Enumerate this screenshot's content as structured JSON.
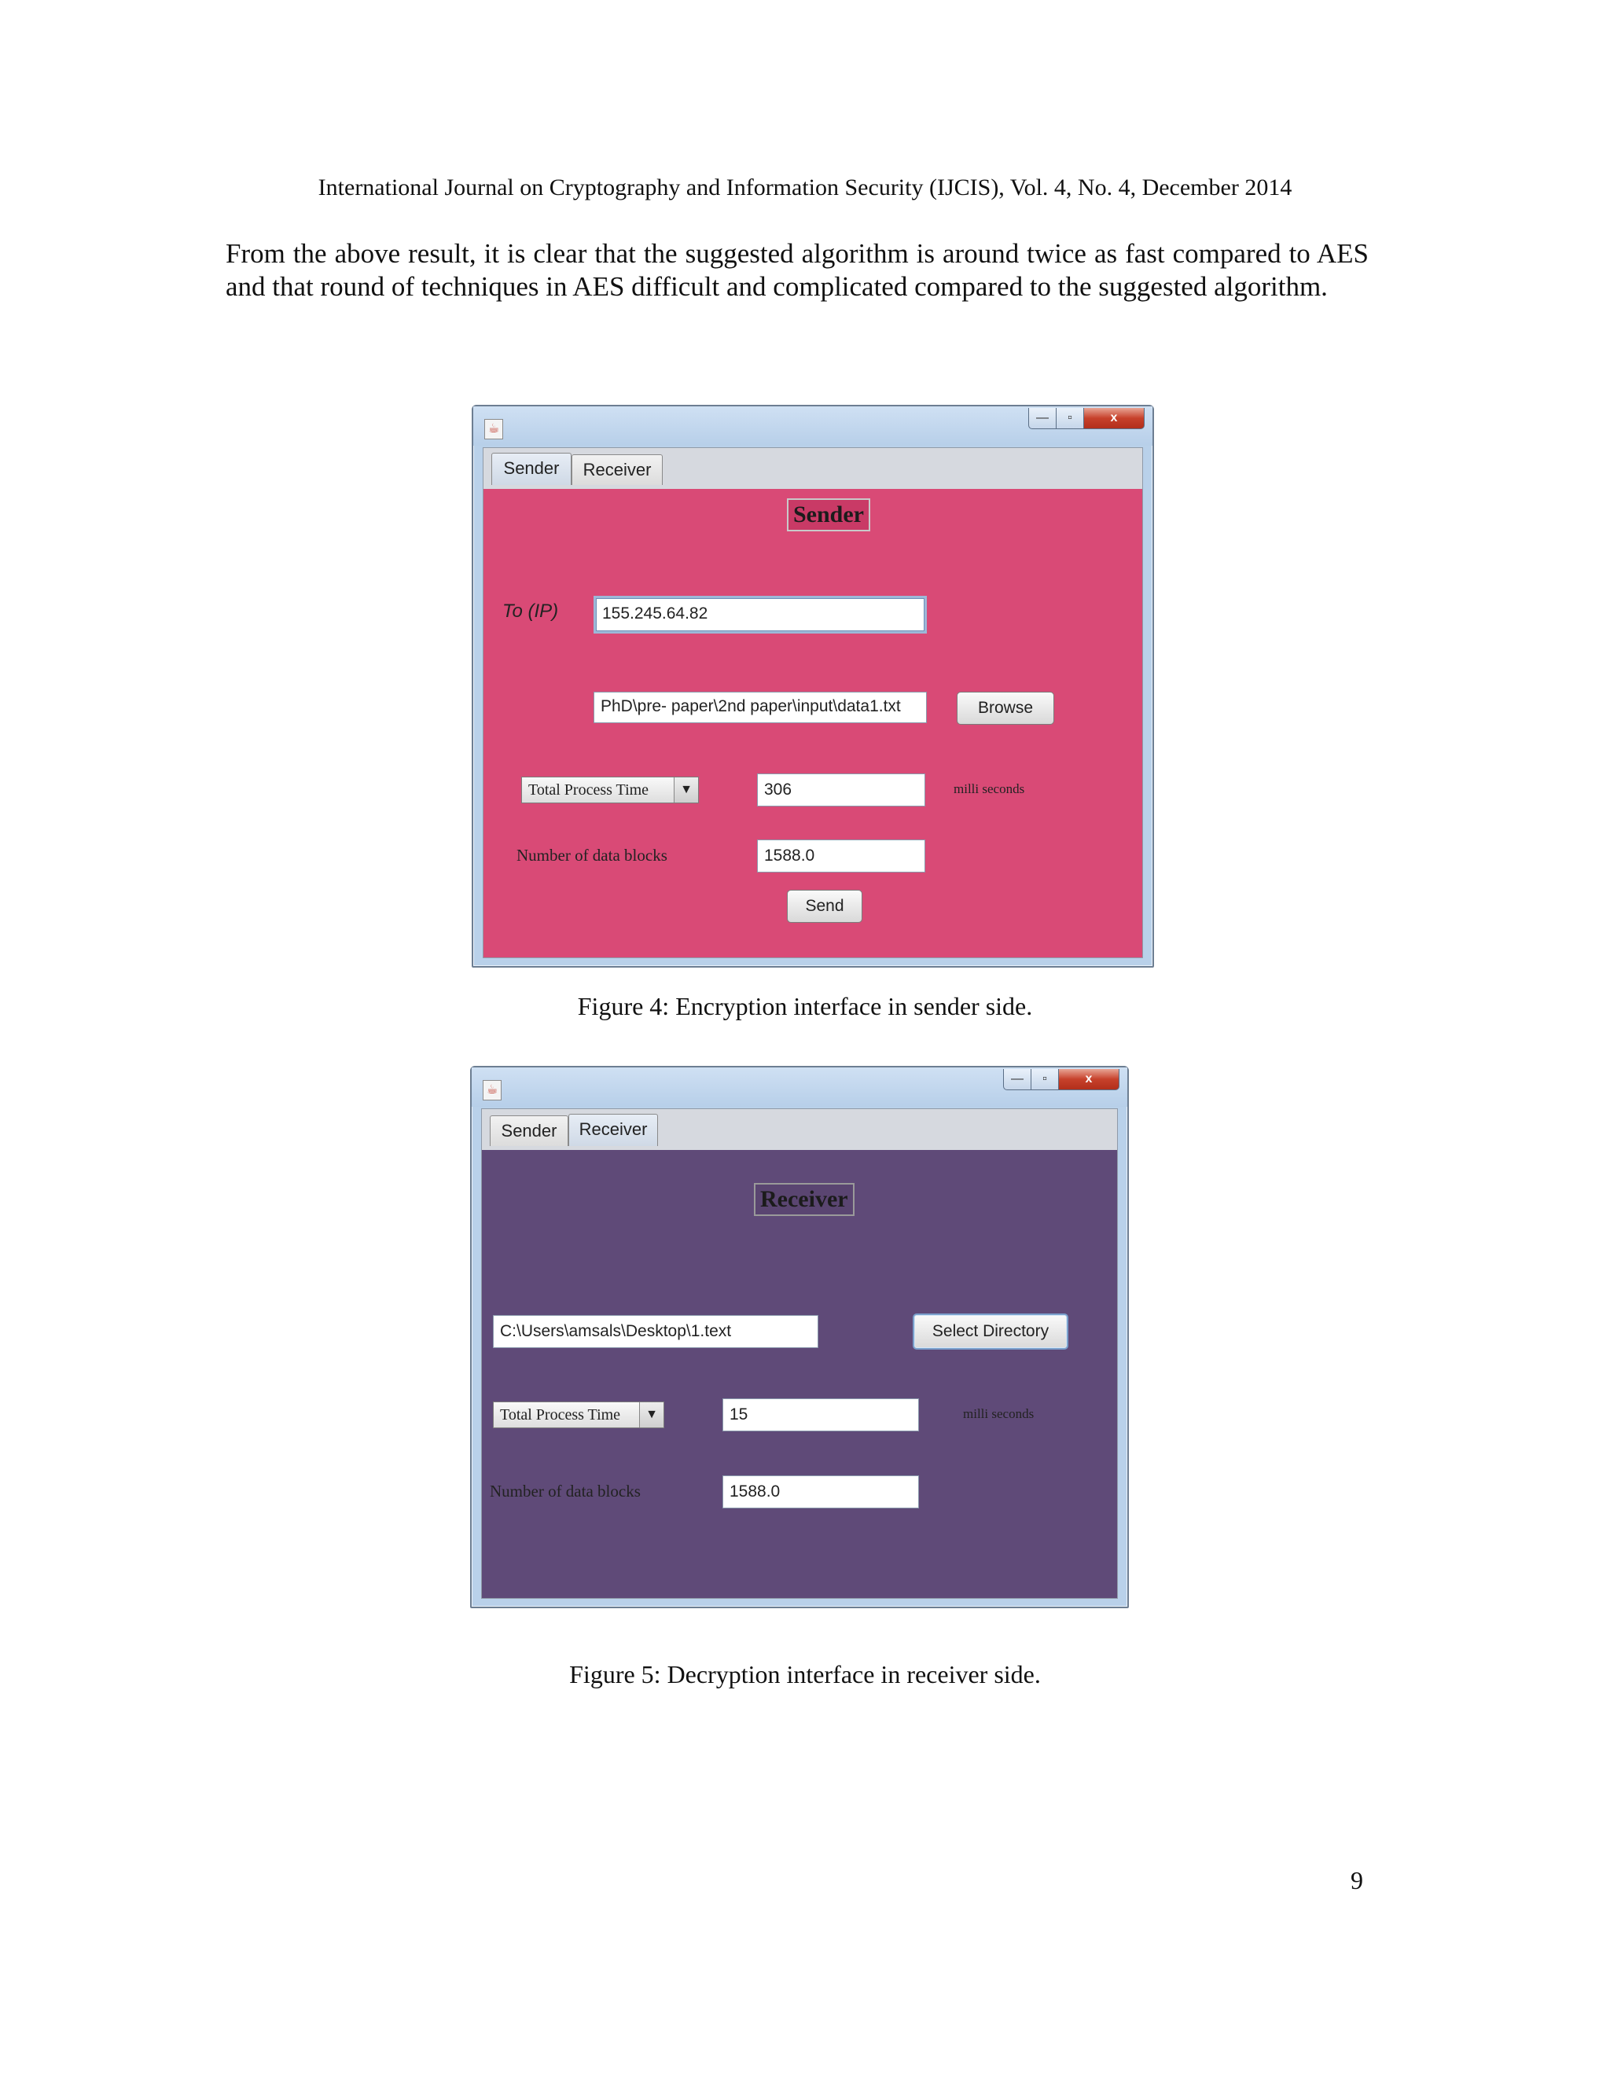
{
  "header": "International Journal on Cryptography and Information Security (IJCIS), Vol. 4, No. 4, December 2014",
  "paragraph": "From the above result, it is clear that the suggested algorithm is around twice as fast compared to AES and that round of techniques in AES difficult and complicated compared to the suggested algorithm.",
  "fig4": {
    "window_controls": {
      "minimize": "—",
      "maximize": "▫",
      "close": "x"
    },
    "tabs": [
      "Sender",
      "Receiver"
    ],
    "active_tab": "Sender",
    "panel_color": "#d94a76",
    "heading": "Sender",
    "ip_label": "To (IP)",
    "ip_value": "155.245.64.82",
    "file_value": "PhD\\pre- paper\\2nd paper\\input\\data1.txt",
    "browse_button": "Browse",
    "combo_value": "Total Process Time",
    "time_value": "306",
    "time_unit": "milli seconds",
    "blocks_label": "Number of data blocks",
    "blocks_value": "1588.0",
    "send_button": "Send",
    "caption": "Figure 4: Encryption interface in sender side."
  },
  "fig5": {
    "window_controls": {
      "minimize": "—",
      "maximize": "▫",
      "close": "x"
    },
    "tabs": [
      "Sender",
      "Receiver"
    ],
    "active_tab": "Receiver",
    "panel_color": "#5f4a78",
    "heading": "Receiver",
    "path_value": "C:\\Users\\amsals\\Desktop\\1.text",
    "select_button": "Select Directory",
    "combo_value": "Total Process Time",
    "time_value": "15",
    "time_unit": "milli seconds",
    "blocks_label": "Number of data blocks",
    "blocks_value": "1588.0",
    "caption": "Figure 5: Decryption interface in receiver side."
  },
  "page_number": "9"
}
